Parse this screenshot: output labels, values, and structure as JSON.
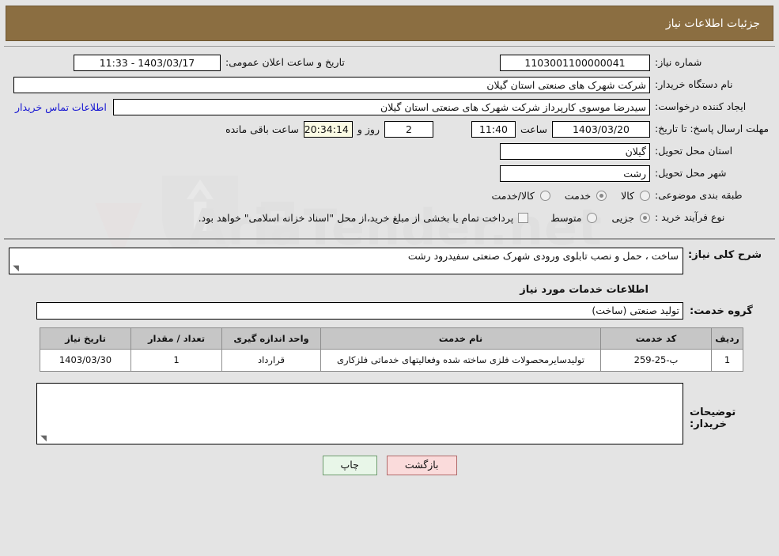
{
  "header": {
    "title": "جزئیات اطلاعات نیاز"
  },
  "fields": {
    "need_number_label": "شماره نیاز:",
    "need_number_value": "1103001100000041",
    "announce_label": "تاریخ و ساعت اعلان عمومی:",
    "announce_value": "1403/03/17 - 11:33",
    "buyer_org_label": "نام دستگاه خریدار:",
    "buyer_org_value": "شرکت شهرک های صنعتی استان گیلان",
    "creator_label": "ایجاد کننده درخواست:",
    "creator_value": "سیدرضا موسوی کارپرداز  شرکت شهرک های صنعتی استان گیلان",
    "contact_link": "اطلاعات تماس خریدار",
    "deadline_label": "مهلت ارسال پاسخ: تا تاریخ:",
    "deadline_date": "1403/03/20",
    "deadline_hour_label": "ساعت",
    "deadline_hour": "11:40",
    "days_value": "2",
    "days_label": "روز و",
    "countdown": "20:34:14",
    "countdown_label": "ساعت باقی مانده",
    "province_label": "استان محل تحویل:",
    "province_value": "گیلان",
    "city_label": "شهر محل تحویل:",
    "city_value": "رشت"
  },
  "classification": {
    "label": "طبقه بندی موضوعی:",
    "options": [
      {
        "label": "کالا",
        "selected": false
      },
      {
        "label": "خدمت",
        "selected": true
      },
      {
        "label": "کالا/خدمت",
        "selected": false
      }
    ]
  },
  "purchase_process": {
    "label": "نوع فرآیند خرید :",
    "options": [
      {
        "label": "جزیی",
        "selected": true
      },
      {
        "label": "متوسط",
        "selected": false
      }
    ]
  },
  "treasury": {
    "checked": false,
    "text": "پرداخت تمام یا بخشی از مبلغ خرید،از محل \"اسناد خزانه اسلامی\" خواهد بود."
  },
  "description": {
    "label": "شرح کلی نیاز:",
    "value": "ساخت ، حمل و نصب تابلوی ورودی شهرک صنعتی سفیدرود رشت"
  },
  "services_section": {
    "title": "اطلاعات خدمات مورد نیاز",
    "group_label": "گروه خدمت:",
    "group_value": "تولید صنعتی (ساخت)"
  },
  "table": {
    "columns": [
      "ردیف",
      "کد خدمت",
      "نام خدمت",
      "واحد اندازه گیری",
      "تعداد / مقدار",
      "تاریخ نیاز"
    ],
    "rows": [
      {
        "index": "1",
        "code": "ب-25-259",
        "name": "تولیدسایرمحصولات فلزی ساخته شده وفعالیتهای خدماتی فلزکاری",
        "unit": "قرارداد",
        "quantity": "1",
        "date": "1403/03/30"
      }
    ]
  },
  "buyer_notes": {
    "label": "توضیحات خریدار:",
    "value": ""
  },
  "footer": {
    "print_label": "چاپ",
    "back_label": "بازگشت"
  },
  "colors": {
    "header_bg": "#8b6e41",
    "link": "#1414d2",
    "table_header_bg": "#c6c6c6",
    "countdown_bg": "#fbfbe4",
    "print_btn_bg": "#e8f6e8",
    "back_btn_bg": "#fadbdb"
  },
  "watermark": {
    "text": "AriaTender.net"
  }
}
